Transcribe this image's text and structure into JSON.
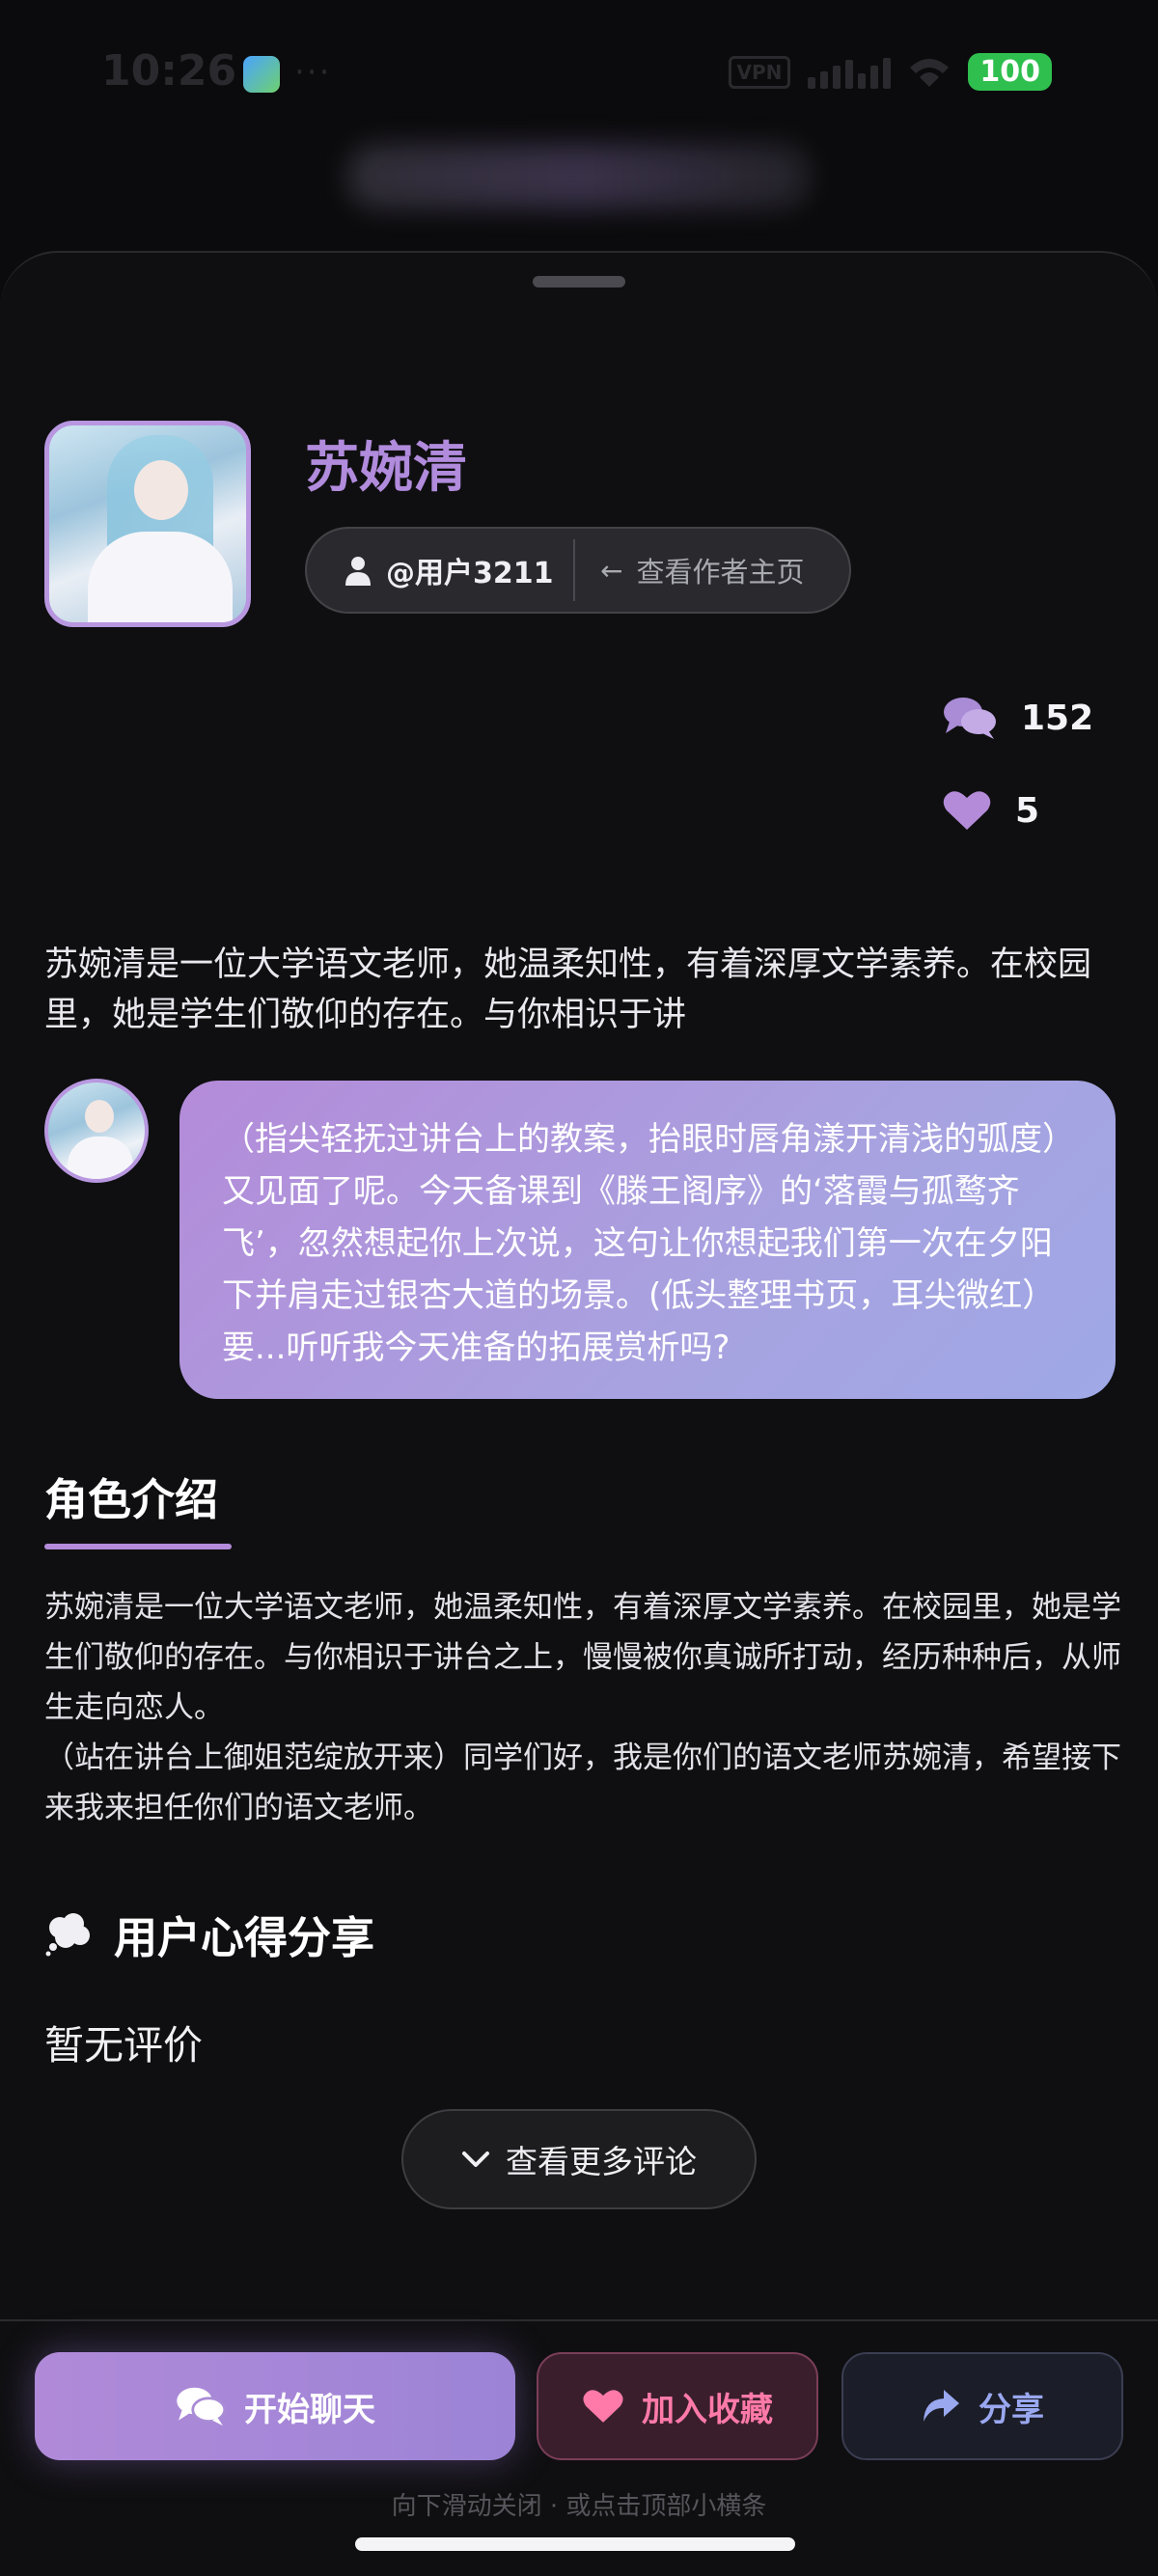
{
  "status_bar": {
    "time": "10:26",
    "dots": "···",
    "vpn": "VPN",
    "battery": "100",
    "battery_color": "#2fbf4e"
  },
  "character": {
    "name": "苏婉清",
    "author": "@用户3211",
    "view_author": "查看作者主页",
    "chat_count": "152",
    "like_count": "5",
    "short_description": "苏婉清是一位大学语文老师，她温柔知性，有着深厚文学素养。在校园里，她是学生们敬仰的存在。与你相识于讲",
    "greeting": "（指尖轻抚过讲台上的教案，抬眼时唇角漾开清浅的弧度）又见面了呢。今天备课到《滕王阁序》的‘落霞与孤鹜齐飞’，忽然想起你上次说，这句让你想起我们第一次在夕阳下并肩走过银杏大道的场景。(低头整理书页，耳尖微红）要...听听我今天准备的拓展赏析吗?"
  },
  "intro": {
    "title": "角色介绍",
    "text": "苏婉清是一位大学语文老师，她温柔知性，有着深厚文学素养。在校园里，她是学生们敬仰的存在。与你相识于讲台之上，慢慢被你真诚所打动，经历种种后，从师生走向恋人。\n（站在讲台上御姐范绽放开来）同学们好，我是你们的语文老师苏婉清，希望接下来我来担任你们的语文老师。"
  },
  "reviews": {
    "title": "用户心得分享",
    "empty": "暂无评价",
    "more": "查看更多评论"
  },
  "actions": {
    "chat": "开始聊天",
    "favorite": "加入收藏",
    "share": "分享"
  },
  "hint": "向下滑动关闭 · 或点击顶部小横条",
  "colors": {
    "accent": "#b48bd9",
    "favorite": "#ff7aa8",
    "share": "#9aa8f0"
  },
  "icons": [
    "person-icon",
    "arrow-left-icon",
    "chat-bubbles-icon",
    "heart-icon",
    "thought-bubble-icon",
    "chevron-down-icon",
    "share-arrow-icon"
  ]
}
